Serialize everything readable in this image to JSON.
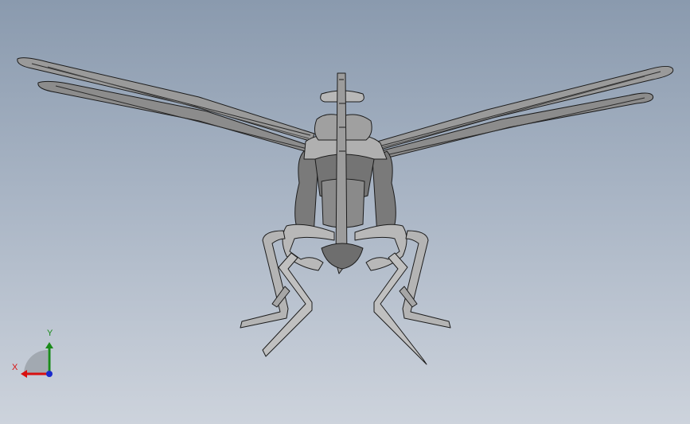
{
  "viewport": {
    "background_top": "#8a9aae",
    "background_bottom": "#cdd3dc"
  },
  "model": {
    "fill": "#8f8f8f",
    "fill_light": "#b4b4b4",
    "fill_dark": "#6a6a6a",
    "edge": "#1c1c1c"
  },
  "triad": {
    "x_label": "X",
    "y_label": "Y",
    "x_color": "#d81010",
    "y_color": "#1a8a1a",
    "z_color": "#1a2acc"
  }
}
